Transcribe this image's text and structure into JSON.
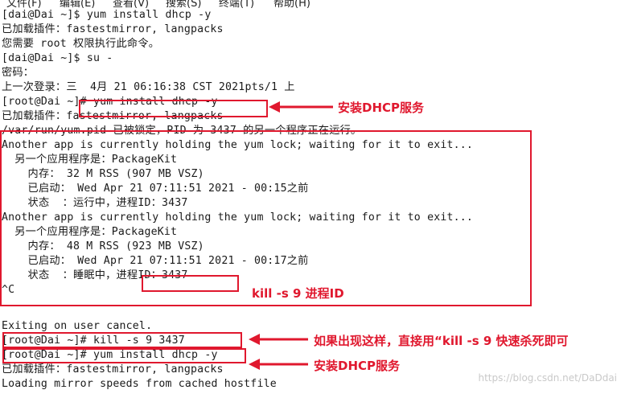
{
  "menu": [
    "文件(F)",
    "编辑(E)",
    "查看(V)",
    "搜索(S)",
    "终端(T)",
    "帮助(H)"
  ],
  "terminal": {
    "lines": [
      "[dai@Dai ~]$ yum install dhcp -y",
      "已加载插件：fastestmirror, langpacks",
      "您需要 root 权限执行此命令。",
      "[dai@Dai ~]$ su -",
      "密码：",
      "上一次登录：三  4月 21 06:16:38 CST 2021pts/1 上",
      "[root@Dai ~]# yum install dhcp -y",
      "已加载插件：fastestmirror, langpacks",
      "/var/run/yum.pid 已被锁定，PID 为 3437 的另一个程序正在运行。",
      "Another app is currently holding the yum lock; waiting for it to exit...",
      "  另一个应用程序是：PackageKit",
      "    内存： 32 M RSS (907 MB VSZ)",
      "    已启动： Wed Apr 21 07:11:51 2021 - 00:15之前",
      "    状态  ：运行中，进程ID：3437",
      "Another app is currently holding the yum lock; waiting for it to exit...",
      "  另一个应用程序是：PackageKit",
      "    内存： 48 M RSS (923 MB VSZ)",
      "    已启动： Wed Apr 21 07:11:51 2021 - 00:17之前",
      "    状态  ：睡眠中，进程ID：3437",
      "^C",
      "",
      "Exiting on user cancel.",
      "[root@Dai ~]# kill -s 9 3437",
      "[root@Dai ~]# yum install dhcp -y",
      "已加载插件：fastestmirror, langpacks",
      "Loading mirror speeds from cached hostfile"
    ]
  },
  "annotations": {
    "install1": "安装DHCP服务",
    "kill": "kill -s  9  进程ID",
    "tip": "如果出现这样，直接用“kill -s 9 快速杀死即可",
    "install2": "安装DHCP服务"
  },
  "watermark": "https://blog.csdn.net/DaDdai",
  "colors": {
    "annotation": "#e0182e",
    "text": "#1a1a1a",
    "background": "#ffffff"
  }
}
